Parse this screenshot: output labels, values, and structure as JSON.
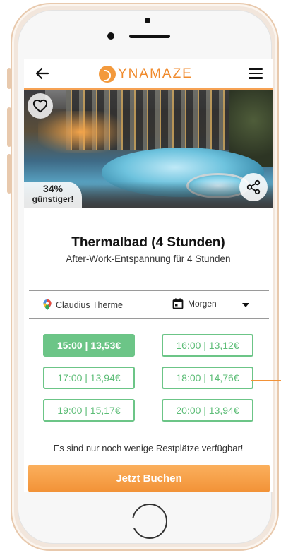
{
  "app": {
    "logo_text": "YNAMAZE",
    "accent_color": "#f39a3d",
    "slot_color": "#6cc587"
  },
  "header": {
    "back_icon": "arrow-left-icon",
    "menu_icon": "hamburger-menu-icon"
  },
  "hero": {
    "discount_percent": "34%",
    "discount_label": "günstiger!",
    "favorite_icon": "heart-icon",
    "share_icon": "share-icon"
  },
  "product": {
    "title": "Thermalbad (4 Stunden)",
    "subtitle": "After-Work-Entspannung für 4 Stunden"
  },
  "filters": {
    "location": "Claudius Therme",
    "date": "Morgen"
  },
  "slots": [
    {
      "label": "15:00 | 13,53€",
      "selected": true
    },
    {
      "label": "16:00 | 13,12€",
      "selected": false
    },
    {
      "label": "17:00 | 13,94€",
      "selected": false
    },
    {
      "label": "18:00 | 14,76€",
      "selected": false
    },
    {
      "label": "19:00 | 15,17€",
      "selected": false
    },
    {
      "label": "20:00 | 13,94€",
      "selected": false
    }
  ],
  "notice": "Es sind nur noch wenige Restplätze verfügbar!",
  "cta": {
    "book_label": "Jetzt Buchen"
  }
}
